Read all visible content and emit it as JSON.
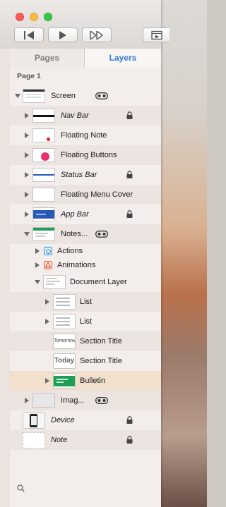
{
  "toolbar": {
    "buttons": [
      "rewind-icon",
      "play-icon",
      "fast-forward-icon",
      "presentation-icon"
    ]
  },
  "tabs": {
    "pages": "Pages",
    "layers": "Layers",
    "active": "Layers"
  },
  "page_title": "Page 1",
  "layers": [
    {
      "name": "Screen",
      "italic": false,
      "locked": false,
      "mask": true,
      "expanded": true
    },
    {
      "name": "Nav Bar",
      "italic": true,
      "locked": true,
      "mask": false,
      "expanded": false
    },
    {
      "name": "Floating Note",
      "italic": false,
      "locked": false,
      "mask": false,
      "expanded": false
    },
    {
      "name": "Floating Buttons",
      "italic": false,
      "locked": false,
      "mask": false,
      "expanded": false
    },
    {
      "name": "Status Bar",
      "italic": true,
      "locked": true,
      "mask": false,
      "expanded": false
    },
    {
      "name": "Floating Menu Cover",
      "italic": false,
      "locked": false,
      "mask": false,
      "expanded": false
    },
    {
      "name": "App Bar",
      "italic": true,
      "locked": true,
      "mask": false,
      "expanded": false
    },
    {
      "name": "Notes...",
      "italic": false,
      "locked": false,
      "mask": true,
      "expanded": true
    },
    {
      "name": "Actions",
      "italic": false,
      "locked": false,
      "mask": false,
      "expanded": false
    },
    {
      "name": "Animations",
      "italic": false,
      "locked": false,
      "mask": false,
      "expanded": false
    },
    {
      "name": "Document Layer",
      "italic": false,
      "locked": false,
      "mask": false,
      "expanded": true
    },
    {
      "name": "List",
      "italic": false,
      "locked": false,
      "mask": false,
      "expanded": false
    },
    {
      "name": "List",
      "italic": false,
      "locked": false,
      "mask": false,
      "expanded": false
    },
    {
      "name": "Section Title",
      "italic": false,
      "locked": false,
      "mask": false,
      "thumb_text": "Tomorrow"
    },
    {
      "name": "Section Title",
      "italic": false,
      "locked": false,
      "mask": false,
      "thumb_text": "Today"
    },
    {
      "name": "Bulletin",
      "italic": false,
      "locked": false,
      "mask": false,
      "expanded": false,
      "selected": true
    },
    {
      "name": "Imag...",
      "italic": false,
      "locked": false,
      "mask": true,
      "expanded": false
    },
    {
      "name": "Device",
      "italic": true,
      "locked": true,
      "mask": false
    },
    {
      "name": "Note",
      "italic": true,
      "locked": true,
      "mask": false
    }
  ],
  "colors": {
    "accent": "#2f7bd9",
    "selected_row": "#f0e0cc",
    "pink_dot": "#e8306a",
    "red_dot": "#e02020",
    "blue_bar": "#2a58b8",
    "green_thumb": "#1f9e55"
  }
}
